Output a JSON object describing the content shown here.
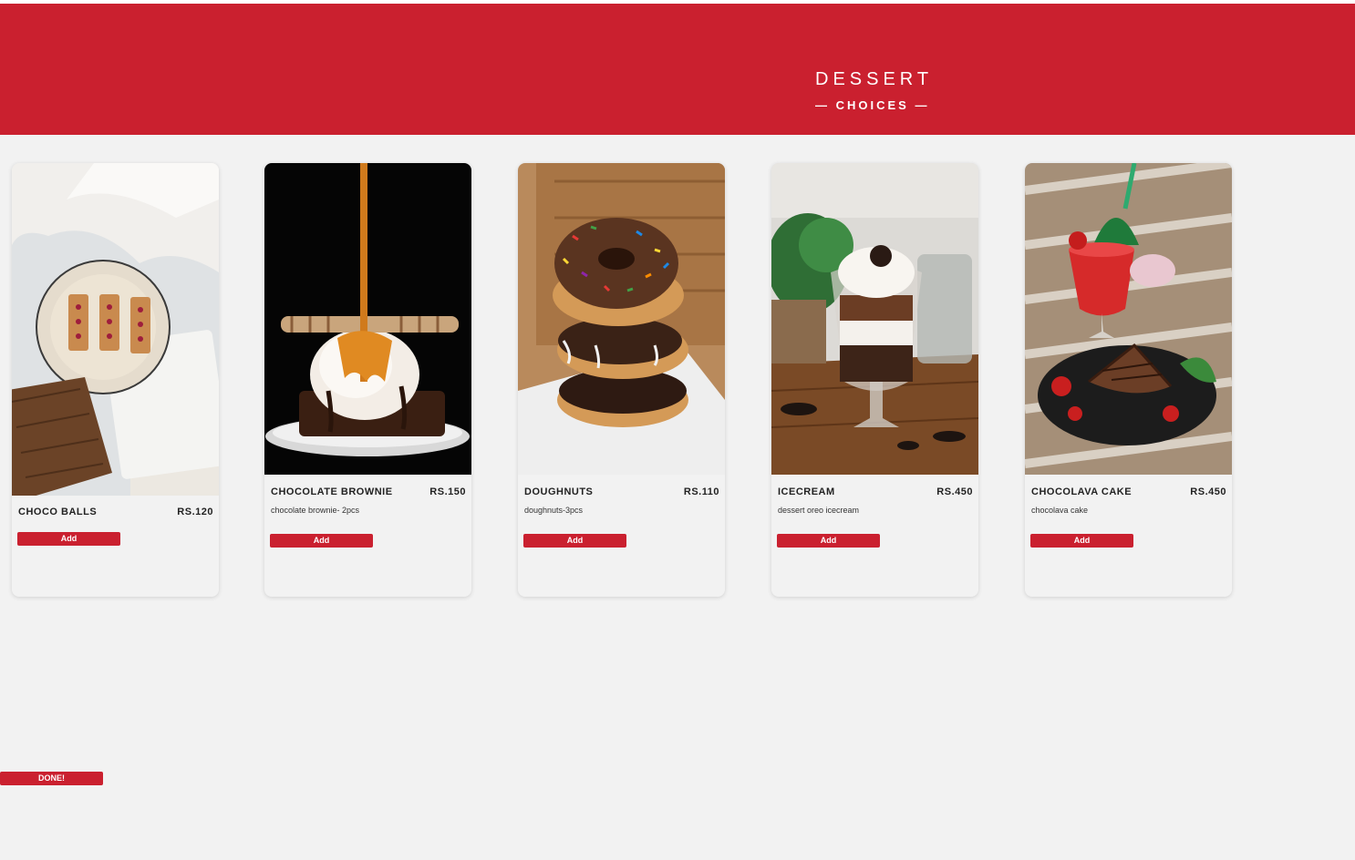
{
  "header": {
    "title": "DESSERT",
    "subtitle": "— CHOICES —"
  },
  "colors": {
    "brand": "#ca202f",
    "background": "#f2f2f2"
  },
  "items": [
    {
      "name": "CHOCO BALLS",
      "price": "RS.120",
      "description": "",
      "button": "Add",
      "image": "choco-balls-photo"
    },
    {
      "name": "CHOCOLATE BROWNIE",
      "price": "RS.150",
      "description": "chocolate brownie- 2pcs",
      "button": "Add",
      "image": "brownie-photo"
    },
    {
      "name": "DOUGHNUTS",
      "price": "RS.110",
      "description": "doughnuts-3pcs",
      "button": "Add",
      "image": "doughnuts-photo"
    },
    {
      "name": "ICECREAM",
      "price": "RS.450",
      "description": "dessert oreo icecream",
      "button": "Add",
      "image": "icecream-photo"
    },
    {
      "name": "CHOCOLAVA CAKE",
      "price": "RS.450",
      "description": "chocolava cake",
      "button": "Add",
      "image": "chocolava-cake-photo"
    }
  ],
  "done_button": "DONE!"
}
